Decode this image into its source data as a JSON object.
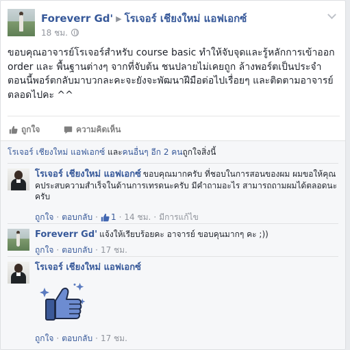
{
  "post": {
    "author": "Foreverr Gd'",
    "target": "โรเจอร์ เชียงใหม่ แอฟเอกซ์",
    "time": "18 ชม.",
    "text": "ขอบคุณอาจารย์โรเจอร์สำหรับ course basic ทำให้จับจุดและรู้หลักการเข้าออก order และ พื้นฐานต่างๆ จากที่จับต้น ชนปลายไม่เคยถูก ล้างพอร์ตเป็นประจำ ตอนนี้พอร์ตกลับมาบวกละคะจะยังจะพัฒนาฝีมือต่อไปเรื่อยๆ และติดตามอาจารย์ตลอดไปคะ ^^"
  },
  "actions": {
    "like": "ถูกใจ",
    "comment": "ความคิดเห็น"
  },
  "likes_summary": {
    "name": "โรเจอร์ เชียงใหม่ แอฟเอกซ์",
    "and": " และ",
    "others": "คนอื่นๆ อีก 2 คน",
    "suffix": "ถูกใจสิ่งนี้"
  },
  "comments": [
    {
      "author": "โรเจอร์ เชียงใหม่ แอฟเอกซ์",
      "text": "ขอบคุณมากครับ ที่ชอบในการสอนของผม ผมขอให้คุณคประสบความสำเร็จในด้านการเทรดนะครับ มีคำถามอะไร สามารถถามผมได้ตลอดนะครับ",
      "like": "ถูกใจ",
      "reply": "ตอบกลับ",
      "like_count": "1",
      "time": "14 ชม.",
      "edited": "มีการแก้ไข"
    },
    {
      "author": "Foreverr Gd'",
      "text": "แจ้งให้เรียบร้อยคะ อาจารย์ ขอบคุนมากๆ คะ ;))",
      "like": "ถูกใจ",
      "reply": "ตอบกลับ",
      "time": "17 ชม."
    },
    {
      "author": "โรเจอร์ เชียงใหม่ แอฟเอกซ์",
      "sticker": "thumbs-up-sticker",
      "like": "ถูกใจ",
      "reply": "ตอบกลับ",
      "time": "17 ชม."
    }
  ],
  "colors": {
    "link": "#365899",
    "meta": "#90949c",
    "text": "#1d2129",
    "ufi_bg": "#f6f7f9",
    "thumb_blue": "#4267b2"
  }
}
